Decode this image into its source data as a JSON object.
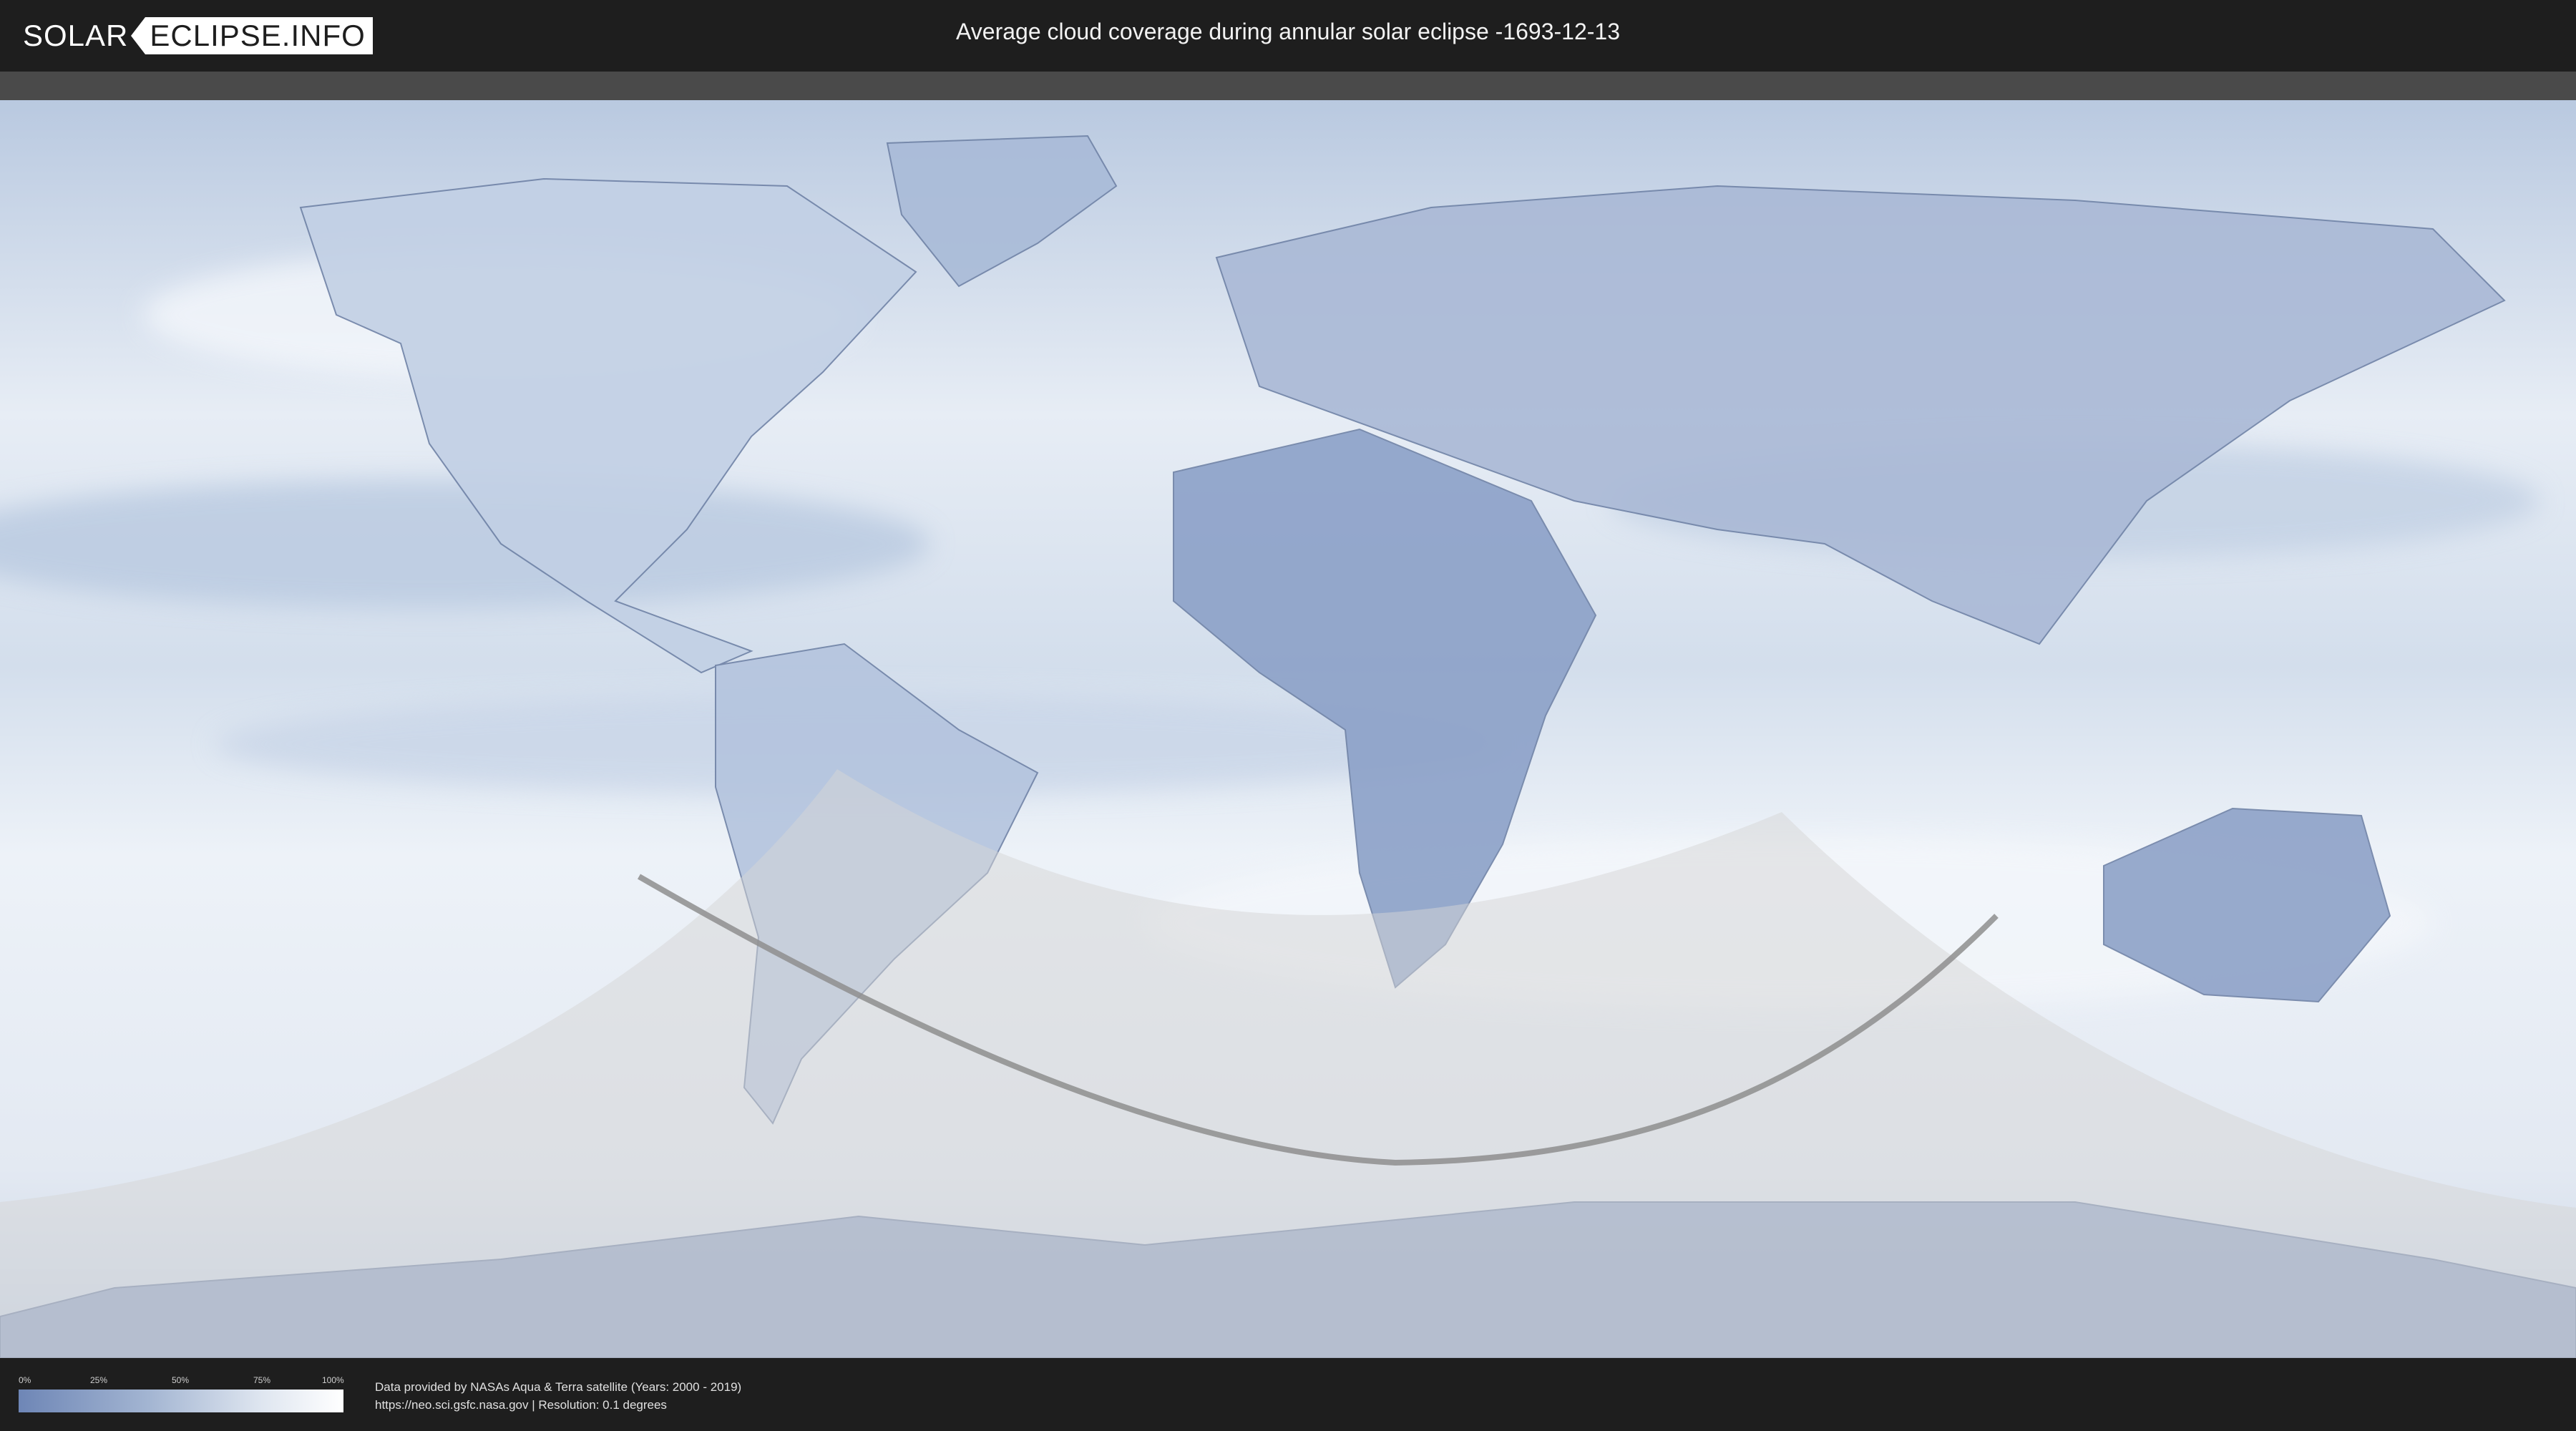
{
  "header": {
    "logo_part1": "SOLAR",
    "logo_part2": "ECLIPSE.INFO",
    "title": "Average cloud coverage during annular solar eclipse -1693-12-13"
  },
  "legend": {
    "ticks": [
      "0%",
      "25%",
      "50%",
      "75%",
      "100%"
    ],
    "gradient_colors": [
      "#6e86b6",
      "#a3b5d2",
      "#dfe6f0",
      "#ffffff"
    ]
  },
  "credits": {
    "line1": "Data provided by NASAs Aqua & Terra satellite (Years: 2000 - 2019)",
    "line2": "https://neo.sci.gsfc.nasa.gov | Resolution: 0.1 degrees"
  },
  "colors": {
    "ocean_clouds": "#dde6f1",
    "land_clear": "#7d95c0",
    "eclipse_zone": "#d6d6d6",
    "central_line": "#8e8e8e"
  }
}
